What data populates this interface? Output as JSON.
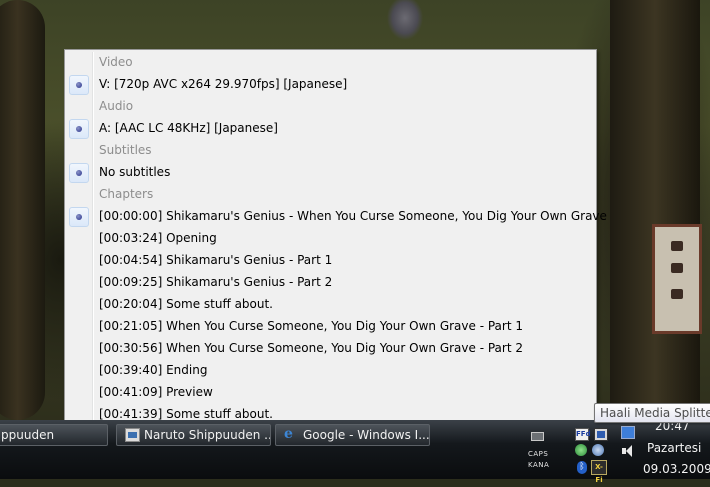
{
  "menu": {
    "rows": [
      {
        "type": "header",
        "label": "Video"
      },
      {
        "type": "item",
        "label": "V: [720p AVC x264 29.970fps] [Japanese]",
        "checked": true
      },
      {
        "type": "header",
        "label": "Audio"
      },
      {
        "type": "item",
        "label": "A: [AAC LC 48KHz] [Japanese]",
        "checked": true
      },
      {
        "type": "header",
        "label": "Subtitles"
      },
      {
        "type": "item",
        "label": "No subtitles",
        "checked": true
      },
      {
        "type": "header",
        "label": "Chapters"
      },
      {
        "type": "item",
        "label": "[00:00:00] Shikamaru's Genius - When You Curse Someone, You Dig Your Own Grave",
        "checked": true
      },
      {
        "type": "item",
        "label": "[00:03:24] Opening",
        "checked": false
      },
      {
        "type": "item",
        "label": "[00:04:54] Shikamaru's Genius - Part 1",
        "checked": false
      },
      {
        "type": "item",
        "label": "[00:09:25] Shikamaru's Genius - Part 2",
        "checked": false
      },
      {
        "type": "item",
        "label": "[00:20:04] Some stuff about.",
        "checked": false
      },
      {
        "type": "item",
        "label": "[00:21:05] When You Curse Someone, You Dig Your Own Grave - Part 1",
        "checked": false
      },
      {
        "type": "item",
        "label": "[00:30:56] When You Curse Someone, You Dig Your Own Grave - Part 2",
        "checked": false
      },
      {
        "type": "item",
        "label": "[00:39:40] Ending",
        "checked": false
      },
      {
        "type": "item",
        "label": "[00:41:09] Preview",
        "checked": false
      },
      {
        "type": "item",
        "label": "[00:41:39] Some stuff about.",
        "checked": false
      }
    ]
  },
  "taskbar": {
    "buttons": [
      {
        "label": "ppuuden",
        "icon": "none"
      },
      {
        "label": "Naruto Shippuuden ...",
        "icon": "media-player-icon"
      },
      {
        "label": "Google - Windows I...",
        "icon": "internet-explorer-icon"
      }
    ],
    "indicators": {
      "caps": "CAPS",
      "kana": "KANA"
    },
    "tray_text": {
      "ffdshow": "FFd",
      "bluetooth": "ᛒ",
      "xfi": "X-Fi"
    },
    "clock": {
      "time": "20:47",
      "day": "Pazartesi",
      "date": "09.03.2009"
    }
  },
  "tooltip": {
    "text": "Haali Media Splitter"
  },
  "colors": {
    "menu_bg": "#f0f0f0",
    "header_text": "#8d8d8d",
    "radio_dot": "#2a338a"
  }
}
